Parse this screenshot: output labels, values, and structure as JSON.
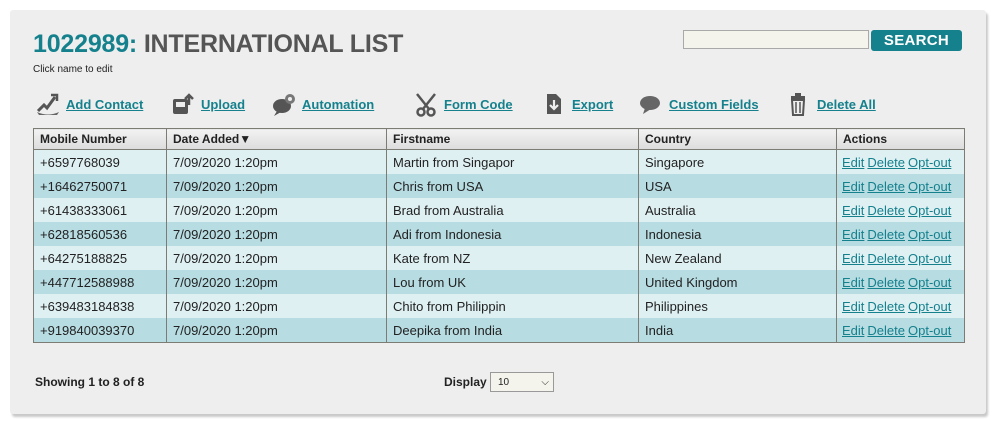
{
  "header": {
    "list_id": "1022989:",
    "list_name": "INTERNATIONAL LIST",
    "hint": "Click name to edit"
  },
  "search": {
    "value": "",
    "button_label": "SEARCH"
  },
  "toolbar": {
    "add_contact": "Add Contact",
    "upload": "Upload",
    "automation": "Automation",
    "form_code": "Form Code",
    "export": "Export",
    "custom_fields": "Custom Fields",
    "delete_all": "Delete All"
  },
  "table": {
    "columns": [
      "Mobile Number",
      "Date Added▼",
      "Firstname",
      "Country",
      "Actions"
    ],
    "action_labels": {
      "edit": "Edit",
      "delete": "Delete",
      "optout": "Opt-out"
    },
    "rows": [
      [
        "+6597768039",
        "7/09/2020 1:20pm",
        "Martin from Singapor",
        "Singapore"
      ],
      [
        "+16462750071",
        "7/09/2020 1:20pm",
        "Chris from USA",
        "USA"
      ],
      [
        "+61438333061",
        "7/09/2020 1:20pm",
        "Brad from Australia",
        "Australia"
      ],
      [
        "+62818560536",
        "7/09/2020 1:20pm",
        "Adi from Indonesia",
        "Indonesia"
      ],
      [
        "+64275188825",
        "7/09/2020 1:20pm",
        "Kate from NZ",
        "New Zealand"
      ],
      [
        "+447712588988",
        "7/09/2020 1:20pm",
        "Lou from UK",
        "United Kingdom"
      ],
      [
        "+639483184838",
        "7/09/2020 1:20pm",
        "Chito from Philippin",
        "Philippines"
      ],
      [
        "+919840039370",
        "7/09/2020 1:20pm",
        "Deepika from India",
        "India"
      ]
    ]
  },
  "footer": {
    "showing": "Showing 1 to 8 of 8",
    "display_label": "Display",
    "display_value": "10"
  },
  "colors": {
    "accent": "#14818d",
    "row_light": "#dff0f3",
    "row_dark": "#b7dce2"
  }
}
